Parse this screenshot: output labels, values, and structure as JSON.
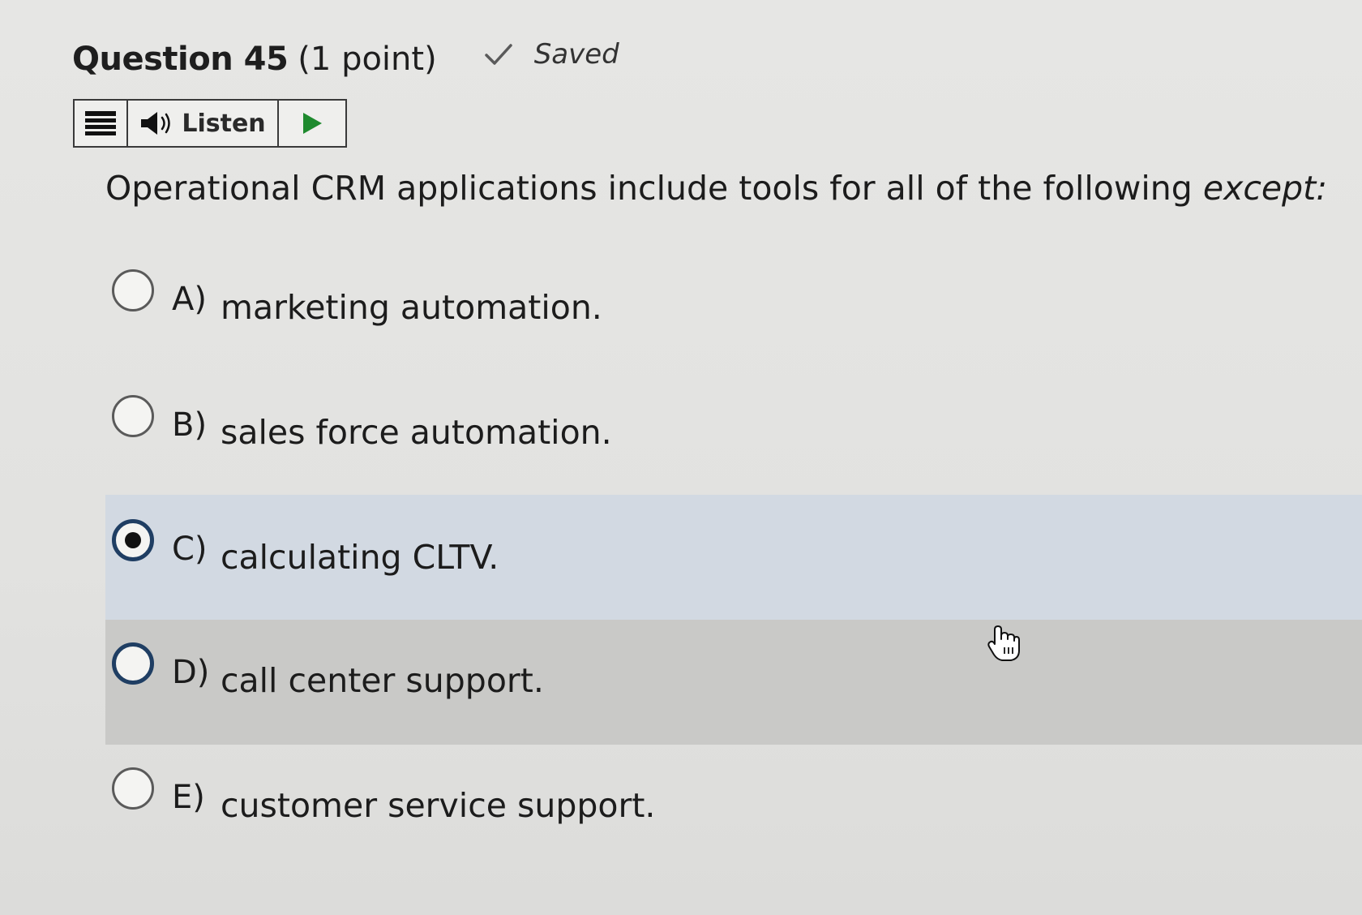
{
  "question": {
    "title": "Question 45",
    "points": "(1 point)",
    "status": "Saved"
  },
  "toolbar": {
    "listen_label": "Listen"
  },
  "prompt": {
    "text": "Operational CRM applications include tools for all of the following ",
    "emphasis": "except:"
  },
  "options": [
    {
      "letter": "A)",
      "text": "marketing automation.",
      "selected": false
    },
    {
      "letter": "B)",
      "text": "sales force automation.",
      "selected": false
    },
    {
      "letter": "C)",
      "text": "calculating CLTV.",
      "selected": true
    },
    {
      "letter": "D)",
      "text": "call center support.",
      "selected": false
    },
    {
      "letter": "E)",
      "text": "customer service support.",
      "selected": false
    }
  ],
  "colors": {
    "selected_row": "#d2d9e2",
    "hover_row": "#c9c9c7",
    "radio_focus": "#1f3e63",
    "play_icon": "#1e8a2e",
    "saved_check": "#555555"
  },
  "icons": {
    "menu": "menu-icon",
    "speaker": "speaker-icon",
    "play": "play-icon",
    "check": "check-icon",
    "cursor": "hand-pointer-icon"
  }
}
